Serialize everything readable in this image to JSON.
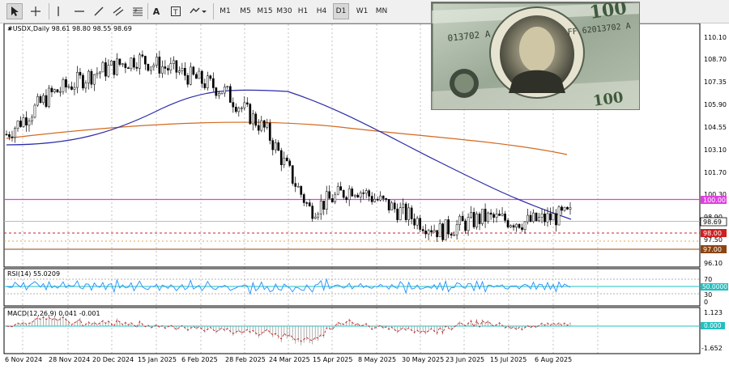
{
  "toolbar": {
    "timeframes": [
      "M1",
      "M5",
      "M15",
      "M30",
      "H1",
      "H4",
      "D1",
      "W1",
      "MN"
    ],
    "selected_timeframe": "D1",
    "tools": [
      "cursor-icon",
      "crosshair-icon",
      "vertical-line-icon",
      "horizontal-line-icon",
      "trendline-icon",
      "channel-icon",
      "fibonacci-icon",
      "text-icon",
      "label-icon",
      "arrows-icon"
    ]
  },
  "main_chart": {
    "header": "#USDX,Daily  98.61 98.80 98.55 98.69",
    "price_labels": [
      "110.10",
      "108.70",
      "107.35",
      "105.90",
      "104.55",
      "103.10",
      "101.70",
      "100.30",
      "98.90",
      "97.50",
      "96.10"
    ],
    "level_labels": {
      "level_100": "100.00",
      "current": "98.69",
      "level_98": "98.00",
      "level_97": "97.00"
    },
    "colors": {
      "level_100": "#e040e0",
      "level_98": "#cc2222",
      "level_97": "#8b4513",
      "ma_slow": "#2b2ba8",
      "ma_200": "#d2691e",
      "candles": "#000000"
    }
  },
  "rsi": {
    "header": "RSI(14) 55.0209",
    "labels": [
      "70",
      "50.0000",
      "30",
      "0"
    ]
  },
  "macd": {
    "header": "MACD(12,26,9) 0.041 -0.001",
    "labels": [
      "1.123",
      "0.000",
      "-1.652"
    ]
  },
  "date_labels": [
    "6 Nov 2024",
    "28 Nov 2024",
    "20 Dec 2024",
    "15 Jan 2025",
    "6 Feb 2025",
    "28 Feb 2025",
    "24 Mar 2025",
    "15 Apr 2025",
    "8 May 2025",
    "30 May 2025",
    "23 Jun 2025",
    "15 Jul 2025",
    "6 Aug 2025"
  ],
  "photo_text": {
    "serial": "FF 62013702 A",
    "serial2": "013702 A"
  },
  "chart_data": [
    {
      "type": "candlestick",
      "title": "#USDX,Daily",
      "x": [
        "2024-11-06",
        "2024-11-28",
        "2024-12-20",
        "2025-01-15",
        "2025-02-06",
        "2025-02-28",
        "2025-03-24",
        "2025-04-15",
        "2025-05-08",
        "2025-05-30",
        "2025-06-23",
        "2025-07-15",
        "2025-08-06",
        "2025-08-22"
      ],
      "close_approx": [
        104.0,
        106.6,
        108.0,
        109.0,
        108.1,
        106.9,
        104.2,
        99.0,
        100.5,
        99.0,
        97.6,
        98.5,
        98.2,
        98.7
      ],
      "ylim": [
        95.5,
        111.0
      ],
      "lines": [
        {
          "name": "",
          "values": [
            103.0,
            104.6,
            106.3,
            106.9,
            106.8,
            106.8,
            105.2,
            103.1,
            102.0,
            101.0,
            99.9,
            98.8,
            98.4
          ]
        },
        {
          "name": "",
          "values": [
            103.6,
            104.1,
            104.5,
            104.9,
            105.0,
            104.9,
            104.7,
            104.4,
            104.1,
            103.8,
            103.5,
            103.1,
            102.9
          ]
        }
      ],
      "levels": [
        100.0,
        98.0,
        97.0
      ]
    },
    {
      "type": "line",
      "title": "RSI(14) 55.0209",
      "ylim": [
        0,
        100
      ],
      "levels": [
        30,
        50,
        70
      ]
    },
    {
      "type": "bar",
      "title": "MACD(12,26,9) 0.041 -0.001",
      "ylim": [
        -1.652,
        1.123
      ]
    }
  ]
}
